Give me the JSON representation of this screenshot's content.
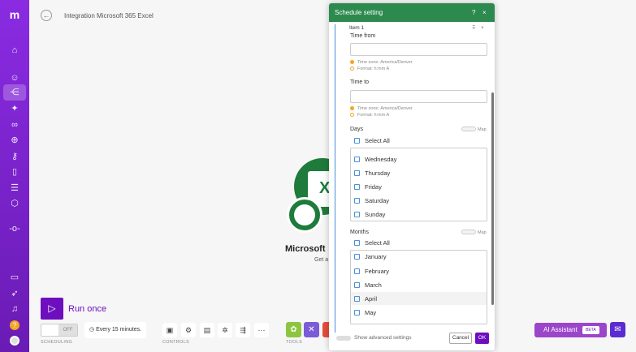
{
  "header": {
    "title": "Integration Microsoft 365 Excel"
  },
  "module": {
    "name": "Microsoft",
    "subtitle": "Get a"
  },
  "bottom": {
    "run_label": "Run once",
    "scheduling_toggle": "OFF",
    "schedule_text": "Every 15 minutes.",
    "scheduling_label": "SCHEDULING",
    "controls_label": "CONTROLS",
    "tools_label": "TOOLS",
    "ai_label": "AI Assistant",
    "beta_label": "BETA"
  },
  "modal": {
    "title": "Schedule setting",
    "help": "?",
    "close": "×",
    "item_label": "Item 1",
    "time_from_label": "Time from",
    "time_from_tz": "Time zone: America/Denver",
    "time_from_format": "Format: h:mm A",
    "time_to_label": "Time to",
    "time_to_tz": "Time zone: America/Denver",
    "time_to_format": "Format: h:mm A",
    "days_label": "Days",
    "months_label": "Months",
    "map_label": "Map",
    "select_all": "Select All",
    "days": [
      "Wednesday",
      "Thursday",
      "Friday",
      "Saturday",
      "Sunday"
    ],
    "months": [
      "January",
      "February",
      "March",
      "April",
      "May"
    ],
    "advanced": "Show advanced settings",
    "cancel": "Cancel",
    "ok": "OK"
  },
  "colors": {
    "brand": "#6d0fbf",
    "modal_header": "#2d8a4e",
    "excel_green": "#1e7b3b"
  }
}
